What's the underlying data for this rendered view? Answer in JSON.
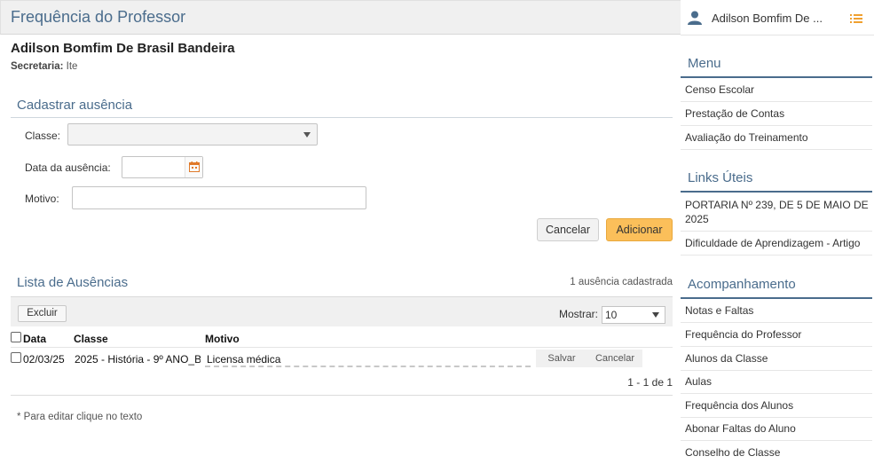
{
  "header": {
    "title": "Frequência do Professor"
  },
  "user": {
    "name": "Adilson Bomfim De ..."
  },
  "person": {
    "name": "Adilson Bomfim De Brasil Bandeira",
    "secretaria_label": "Secretaria:",
    "secretaria_value": "Ite"
  },
  "form": {
    "section_title": "Cadastrar ausência",
    "classe_label": "Classe:",
    "classe_value": "",
    "data_label": "Data da ausência:",
    "data_value": "",
    "motivo_label": "Motivo:",
    "motivo_value": "",
    "cancel_label": "Cancelar",
    "add_label": "Adicionar"
  },
  "list": {
    "section_title": "Lista de Ausências",
    "count_text": "1 ausência cadastrada",
    "excluir_label": "Excluir",
    "mostrar_label": "Mostrar:",
    "mostrar_value": "10",
    "columns": [
      "Data",
      "Classe",
      "Motivo"
    ],
    "rows": [
      {
        "data": "02/03/25",
        "classe": "2025 - História - 9º ANO_B",
        "motivo": "Licensa médica",
        "save_label": "Salvar",
        "cancel_label": "Cancelar"
      }
    ],
    "pager_text": "1 - 1 de 1",
    "note": "* Para editar clique no texto"
  },
  "sidebar": {
    "menu": {
      "title": "Menu",
      "items": [
        "Censo Escolar",
        "Prestação de Contas",
        "Avaliação do Treinamento"
      ]
    },
    "links": {
      "title": "Links Úteis",
      "items": [
        "PORTARIA Nº 239, DE 5 DE MAIO DE 2025",
        "Dificuldade de Aprendizagem - Artigo"
      ]
    },
    "acomp": {
      "title": "Acompanhamento",
      "items": [
        "Notas e Faltas",
        "Frequência do Professor",
        "Alunos da Classe",
        "Aulas",
        "Frequência dos Alunos",
        "Abonar Faltas do Aluno",
        "Conselho de Classe"
      ]
    }
  },
  "colors": {
    "accent": "#4a6c8c",
    "add_button": "#fbbf5a"
  }
}
